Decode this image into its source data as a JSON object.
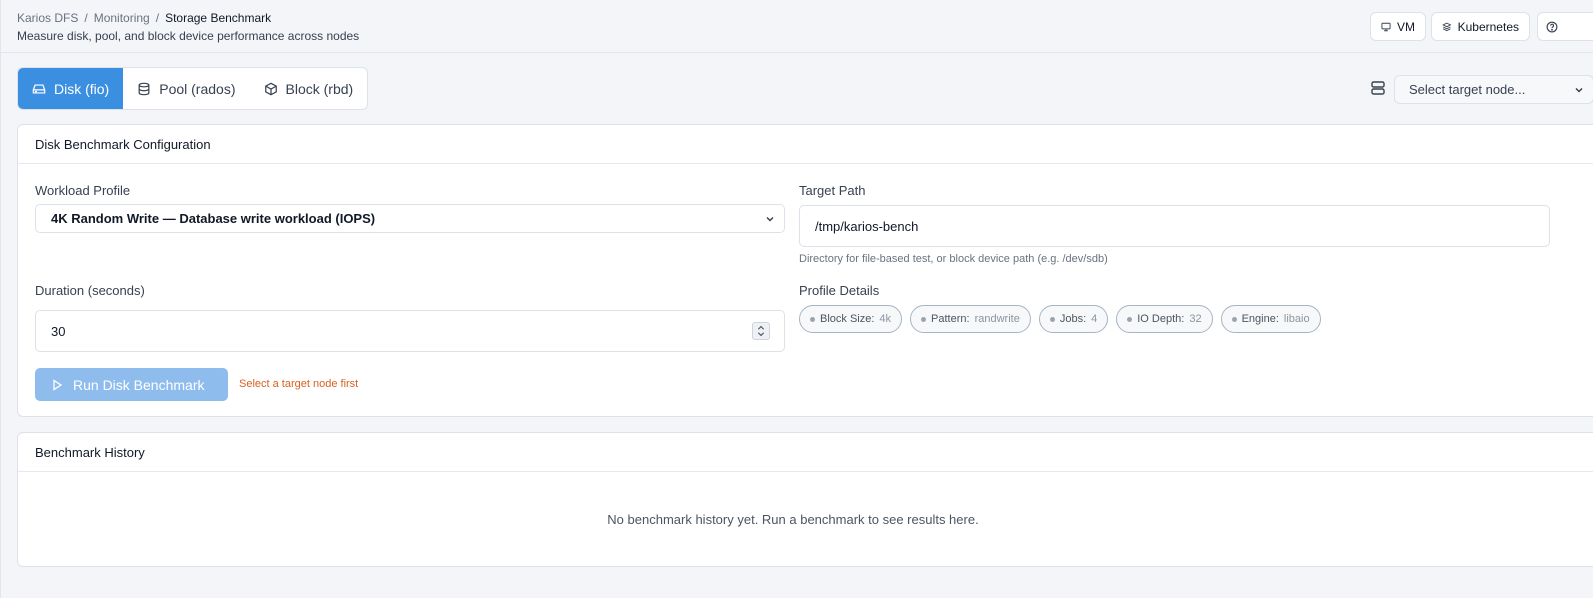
{
  "header": {
    "breadcrumb": [
      "Karios DFS",
      "Monitoring",
      "Storage Benchmark"
    ],
    "separator": "/",
    "subtitle": "Measure disk, pool, and block device performance across nodes",
    "buttons": {
      "vm": "VM",
      "kubernetes": "Kubernetes"
    }
  },
  "tabs": [
    {
      "label": "Disk (fio)",
      "icon": "hard-drive-icon",
      "active": true
    },
    {
      "label": "Pool (rados)",
      "icon": "database-icon",
      "active": false
    },
    {
      "label": "Block (rbd)",
      "icon": "box-icon",
      "active": false
    }
  ],
  "node_select": {
    "placeholder": "Select target node..."
  },
  "config": {
    "title": "Disk Benchmark Configuration",
    "workload_label": "Workload Profile",
    "workload_value": "4K Random Write — Database write workload (IOPS)",
    "target_label": "Target Path",
    "target_value": "/tmp/karios-bench",
    "target_help": "Directory for file-based test, or block device path (e.g. /dev/sdb)",
    "duration_label": "Duration (seconds)",
    "duration_value": "30",
    "profile_label": "Profile Details",
    "chips": [
      {
        "key": "Block Size:",
        "value": "4k"
      },
      {
        "key": "Pattern:",
        "value": "randwrite"
      },
      {
        "key": "Jobs:",
        "value": "4"
      },
      {
        "key": "IO Depth:",
        "value": "32"
      },
      {
        "key": "Engine:",
        "value": "libaio"
      }
    ],
    "run_label": "Run Disk Benchmark",
    "warning": "Select a target node first"
  },
  "history": {
    "title": "Benchmark History",
    "empty": "No benchmark history yet. Run a benchmark to see results here."
  },
  "colors": {
    "accent": "#3b8fe0",
    "disabled_button": "#8ebcec",
    "warning": "#d9601f"
  }
}
